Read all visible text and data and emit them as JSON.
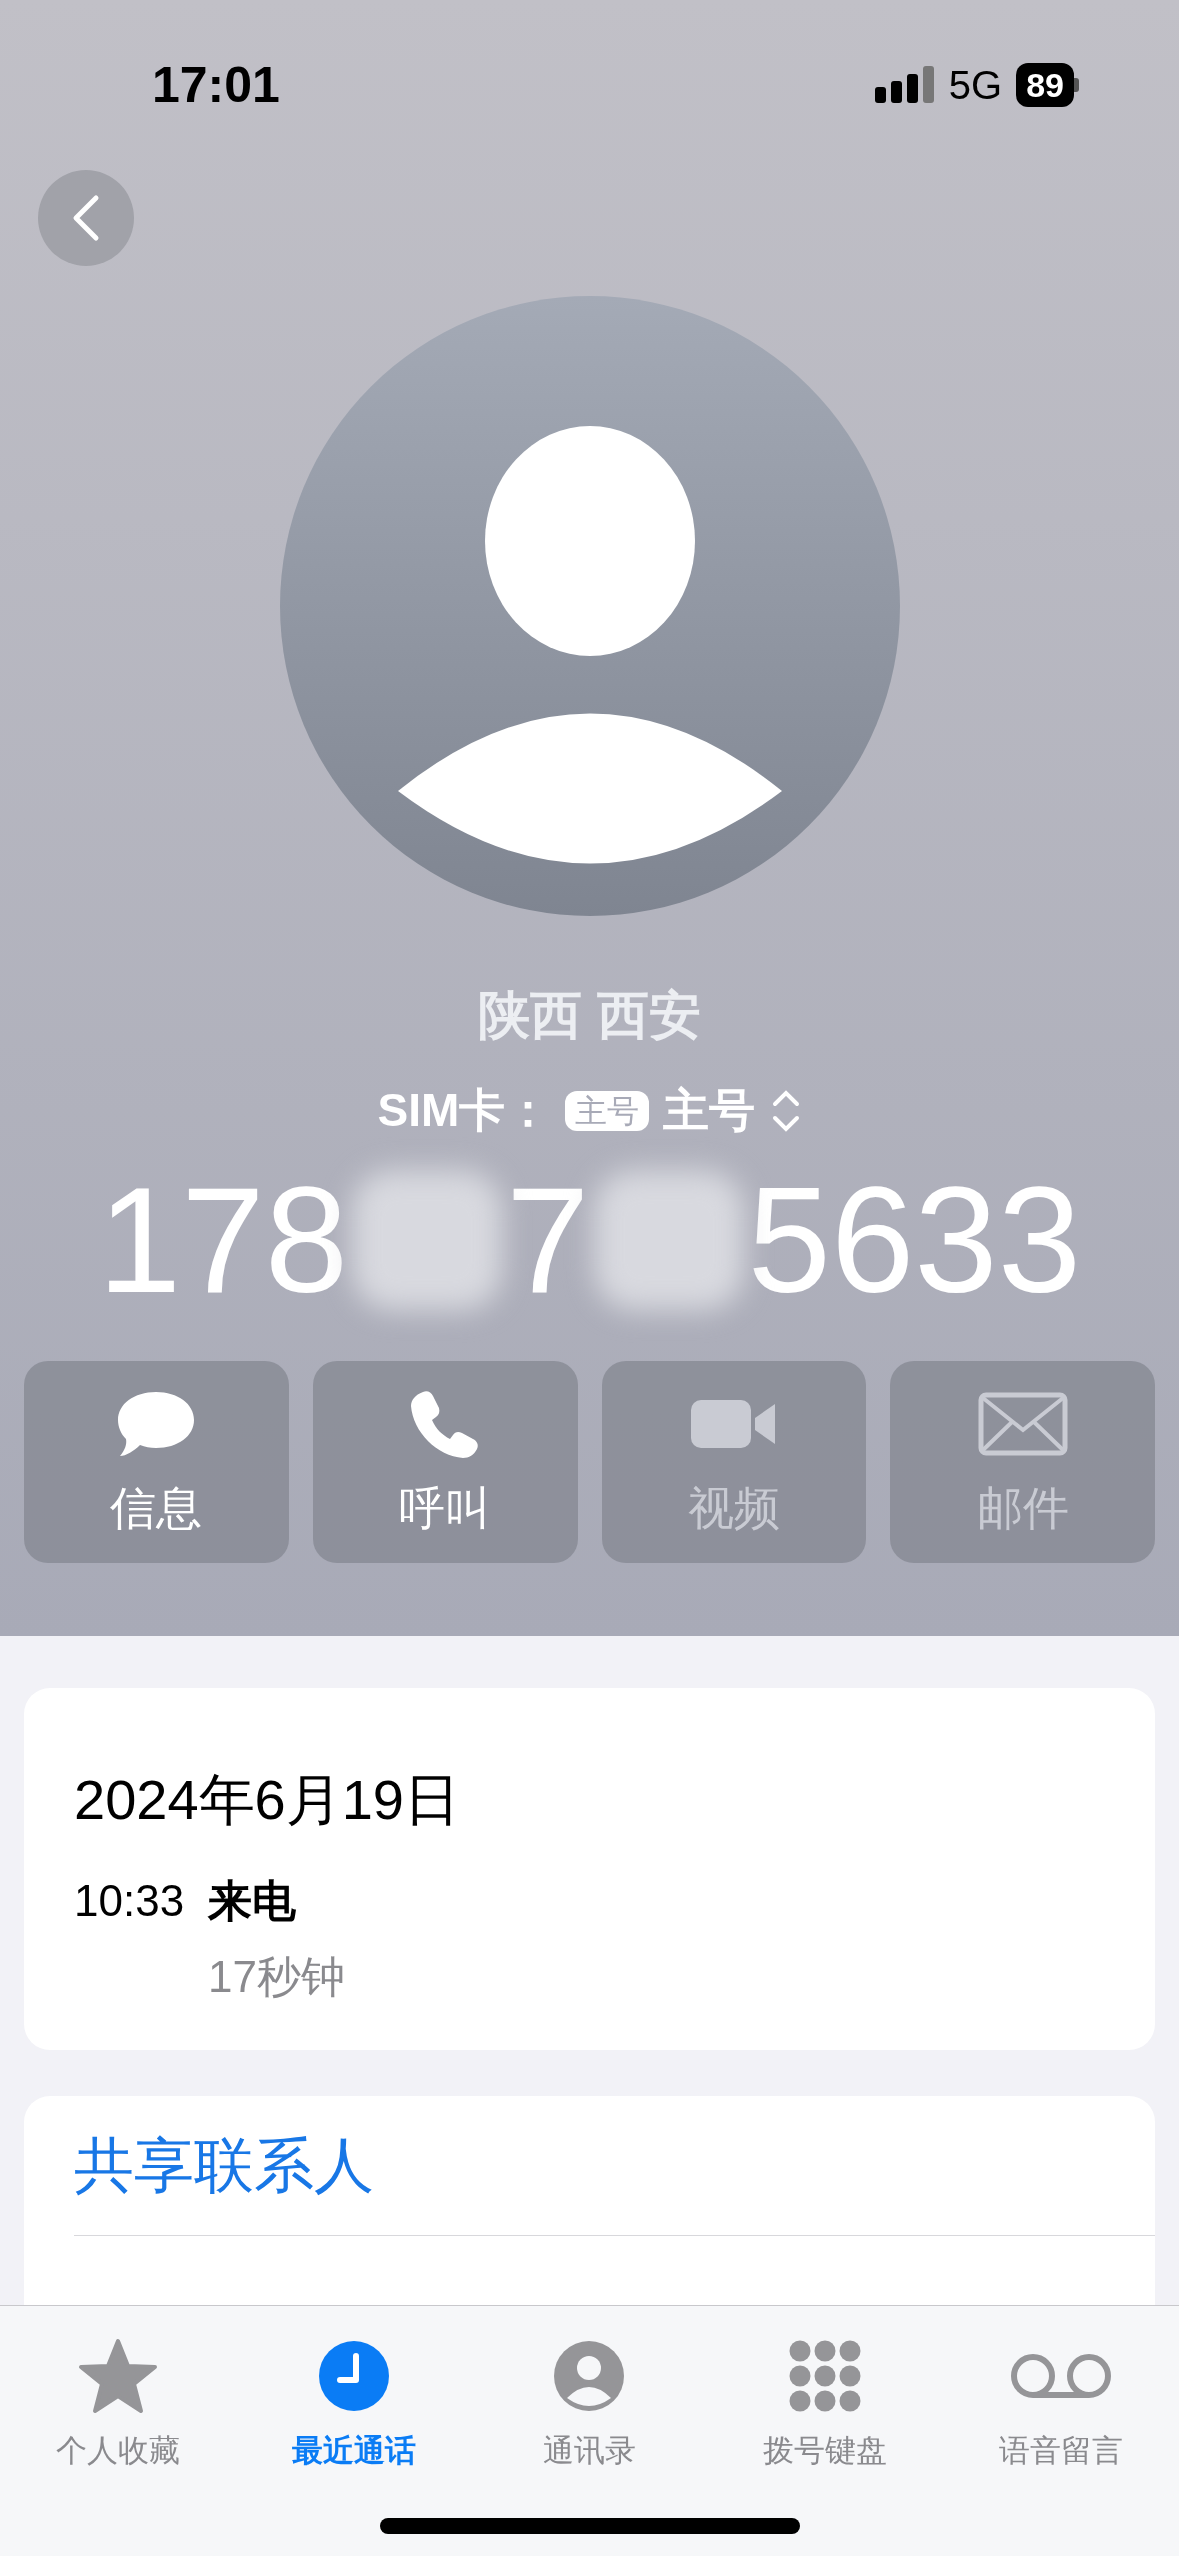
{
  "status_bar": {
    "time": "17:01",
    "network": "5G",
    "battery": "89"
  },
  "contact": {
    "location": "陕西 西安",
    "sim_label": "SIM卡：",
    "sim_badge": "主号",
    "sim_value": "主号",
    "number": [
      {
        "kind": "digits",
        "text": "178"
      },
      {
        "kind": "redacted"
      },
      {
        "kind": "digits",
        "text": "7"
      },
      {
        "kind": "redacted"
      },
      {
        "kind": "digits",
        "text": "5633"
      }
    ]
  },
  "actions": [
    {
      "kind": "message",
      "label": "信息",
      "disabled": false
    },
    {
      "kind": "call",
      "label": "呼叫",
      "disabled": false
    },
    {
      "kind": "video",
      "label": "视频",
      "disabled": true
    },
    {
      "kind": "mail",
      "label": "邮件",
      "disabled": true
    }
  ],
  "history": {
    "date": "2024年6月19日",
    "entries": [
      {
        "time": "10:33",
        "type": "来电",
        "duration": "17秒钟"
      }
    ]
  },
  "links": [
    "共享联系人"
  ],
  "tabs": [
    {
      "kind": "favorites",
      "label": "个人收藏",
      "selected": false
    },
    {
      "kind": "recents",
      "label": "最近通话",
      "selected": true
    },
    {
      "kind": "contacts",
      "label": "通讯录",
      "selected": false
    },
    {
      "kind": "keypad",
      "label": "拨号键盘",
      "selected": false
    },
    {
      "kind": "voicemail",
      "label": "语音留言",
      "selected": false
    }
  ]
}
